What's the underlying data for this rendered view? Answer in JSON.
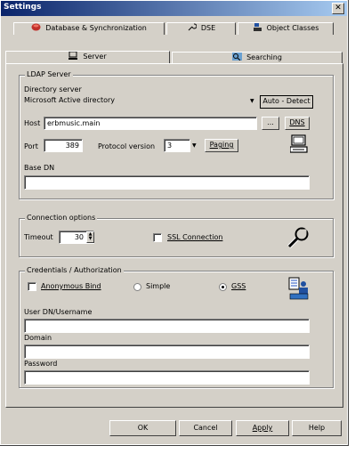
{
  "window": {
    "title": "Settings"
  },
  "tabs": {
    "row1": [
      "Database & Synchronization",
      "DSE",
      "Object Classes"
    ],
    "row2": [
      "Server",
      "Searching"
    ]
  },
  "ldap": {
    "group_title": "LDAP Server",
    "directory_server_label": "Directory server",
    "directory_server_value": "Microsoft Active directory",
    "autodetect_label": "Auto - Detect",
    "host_label": "Host",
    "host_value": "erbmusic.main",
    "browse_label": "...",
    "dns_label": "DNS",
    "port_label": "Port",
    "port_value": "389",
    "protocol_label": "Protocol version",
    "protocol_value": "3",
    "paging_label": "Paging",
    "basedn_label": "Base DN",
    "basedn_value": ""
  },
  "connection": {
    "group_title": "Connection options",
    "timeout_label": "Timeout",
    "timeout_value": "30",
    "ssl_label": "SSL Connection"
  },
  "credentials": {
    "group_title": "Credentials / Authorization",
    "anon_label": "Anonymous Bind",
    "simple_label": "Simple",
    "gss_label": "GSS",
    "selected": "GSS",
    "user_label": "User DN/Username",
    "user_value": "",
    "domain_label": "Domain",
    "domain_value": "",
    "password_label": "Password",
    "password_value": ""
  },
  "footer": {
    "ok": "OK",
    "cancel": "Cancel",
    "apply": "Apply",
    "help": "Help"
  },
  "colors": {
    "face": "#d4d0c8",
    "title_start": "#0a246a",
    "title_end": "#a6caf0"
  }
}
